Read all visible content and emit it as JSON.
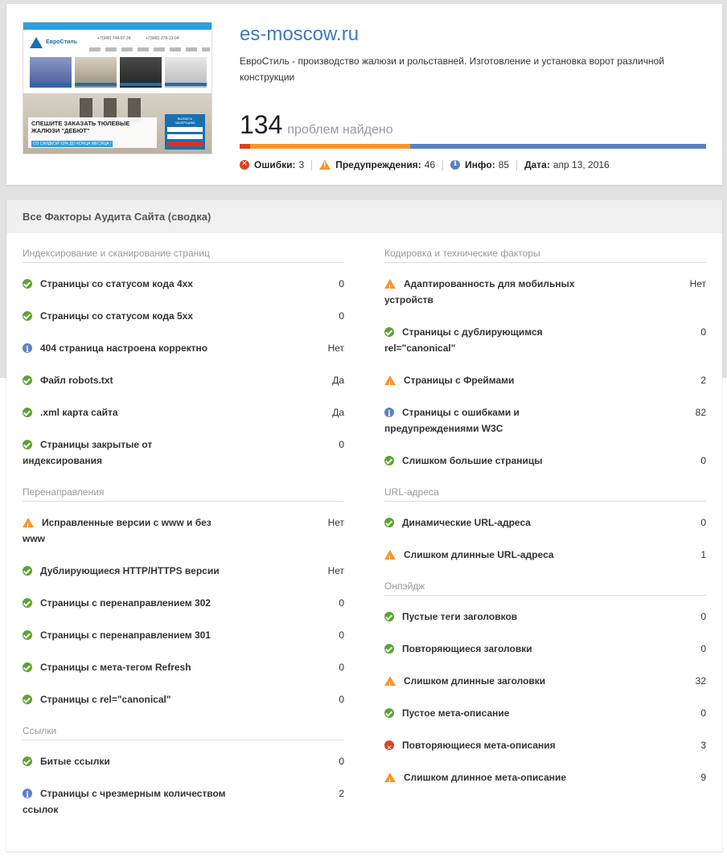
{
  "colors": {
    "link": "#3b7ac0",
    "error": "#e0401f",
    "warning": "#f8952a",
    "info": "#5a82c2",
    "ok": "#5ca332"
  },
  "site": {
    "domain": "es-moscow.ru",
    "description": "ЕвроСтиль - производство жалюзи и рольставней. Изготовление и установка ворот различной конструкции",
    "thumbnail": {
      "logo": "ЕвроСтиль",
      "phone1": "+7(945) 744-07-24",
      "phone2": "+7(945) 278-13-04",
      "banner_title": "СПЕШИТЕ ЗАКАЗАТЬ ТЮЛЕВЫЕ ЖАЛЮЗИ \"ДЕБЮТ\"",
      "banner_sub": "СО СКИДКОЙ 10% ДО КОНЦА МЕСЯЦА !",
      "form_title": "ВЫЗВАТЬ ЗАМЕРЩИКА"
    }
  },
  "summary": {
    "count": "134",
    "count_text": "проблем найдено",
    "bar": {
      "errors": 3,
      "warnings": 46,
      "info": 85
    },
    "errors_label": "Ошибки:",
    "errors_value": "3",
    "warnings_label": "Предупреждения:",
    "warnings_value": "46",
    "info_label": "Инфо:",
    "info_value": "85",
    "date_label": "Дата:",
    "date_value": "апр 13, 2016"
  },
  "panel": {
    "title": "Все Факторы Аудита Сайта (сводка)"
  },
  "left_sections": [
    {
      "title": "Индексирование и сканирование страниц",
      "items": [
        {
          "icon": "check-icon",
          "label": "Страницы со статусом кода 4xx",
          "value": "0"
        },
        {
          "icon": "check-icon",
          "label": "Страницы со статусом кода 5xx",
          "value": "0"
        },
        {
          "icon": "info-icon",
          "label": "404 страница настроена корректно",
          "value": "Нет"
        },
        {
          "icon": "check-icon",
          "label": "Файл robots.txt",
          "value": "Да"
        },
        {
          "icon": "check-icon",
          "label": ".xml карта сайта",
          "value": "Да"
        },
        {
          "icon": "check-icon",
          "label": "Страницы закрытые от индексирования",
          "value": "0"
        }
      ]
    },
    {
      "title": "Перенаправления",
      "items": [
        {
          "icon": "warning-icon",
          "label": "Исправленные версии с www и без www",
          "value": "Нет"
        },
        {
          "icon": "check-icon",
          "label": "Дублирующиеся HTTP/HTTPS версии",
          "value": "Нет"
        },
        {
          "icon": "check-icon",
          "label": "Страницы с перенаправлением 302",
          "value": "0"
        },
        {
          "icon": "check-icon",
          "label": "Страницы с перенаправлением 301",
          "value": "0"
        },
        {
          "icon": "check-icon",
          "label": "Страницы с мета-тегом Refresh",
          "value": "0"
        },
        {
          "icon": "check-icon",
          "label": "Страницы с rel=\"canonical\"",
          "value": "0"
        }
      ]
    },
    {
      "title": "Ссылки",
      "items": [
        {
          "icon": "check-icon",
          "label": "Битые ссылки",
          "value": "0"
        },
        {
          "icon": "info-icon",
          "label": "Страницы с чрезмерным количеством ссылок",
          "value": "2"
        }
      ]
    }
  ],
  "right_sections": [
    {
      "title": "Кодировка и технические факторы",
      "items": [
        {
          "icon": "warning-icon",
          "label": "Адаптированность для мобильных устройств",
          "value": "Нет"
        },
        {
          "icon": "check-icon",
          "label": "Страницы с дублирующимся rel=\"canonical\"",
          "value": "0"
        },
        {
          "icon": "warning-icon",
          "label": "Страницы с Фреймами",
          "value": "2"
        },
        {
          "icon": "info-icon",
          "label": "Страницы с ошибками и предупреждениями W3C",
          "value": "82"
        },
        {
          "icon": "check-icon",
          "label": "Слишком большие страницы",
          "value": "0"
        }
      ]
    },
    {
      "title": "URL-адреса",
      "items": [
        {
          "icon": "check-icon",
          "label": "Динамические URL-адреса",
          "value": "0"
        },
        {
          "icon": "warning-icon",
          "label": "Слишком длинные URL-адреса",
          "value": "1"
        }
      ]
    },
    {
      "title": "Онпэйдж",
      "items": [
        {
          "icon": "check-icon",
          "label": "Пустые теги заголовков",
          "value": "0"
        },
        {
          "icon": "check-icon",
          "label": "Повторяющиеся заголовки",
          "value": "0"
        },
        {
          "icon": "warning-icon",
          "label": "Слишком длинные заголовки",
          "value": "32"
        },
        {
          "icon": "check-icon",
          "label": "Пустое мета-описание",
          "value": "0"
        },
        {
          "icon": "error-icon",
          "label": "Повторяющиеся мета-описания",
          "value": "3"
        },
        {
          "icon": "warning-icon",
          "label": "Слишком длинное мета-описание",
          "value": "9"
        }
      ]
    }
  ]
}
